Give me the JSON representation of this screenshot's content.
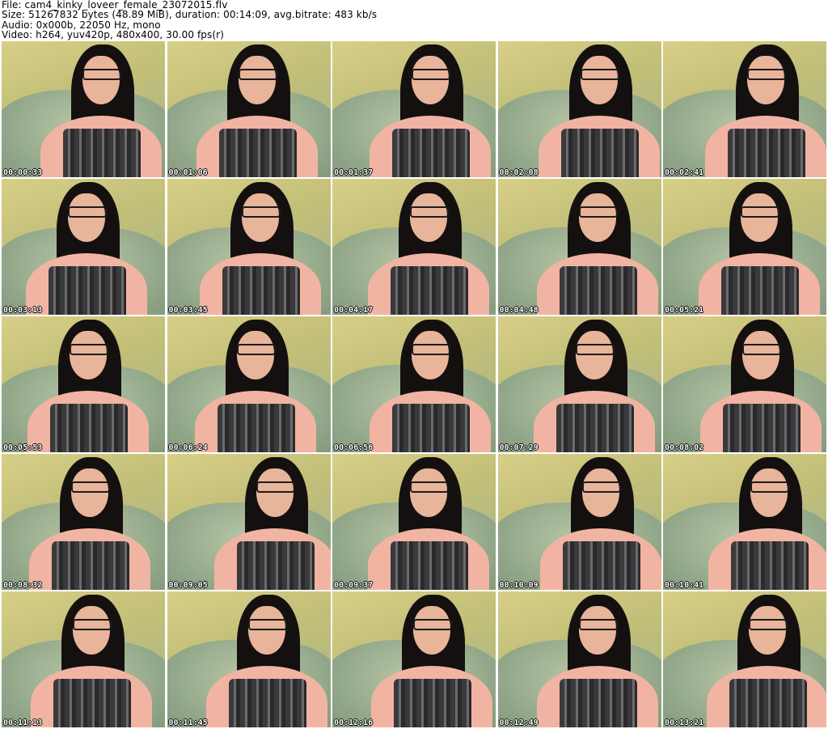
{
  "header": {
    "file_line": "File: cam4_kinky_loveer_female_23072015.flv",
    "size_line": "Size: 51267832 bytes (48.89 MiB), duration: 00:14:09, avg.bitrate: 483 kb/s",
    "audio_line": "Audio: 0x000b, 22050 Hz, mono",
    "video_line": "Video: h264, yuv420p, 480x400, 30.00 fps(r)"
  },
  "thumbnails": [
    {
      "timestamp": "00:00:33"
    },
    {
      "timestamp": "00:01:06"
    },
    {
      "timestamp": "00:01:37"
    },
    {
      "timestamp": "00:02:08"
    },
    {
      "timestamp": "00:02:41"
    },
    {
      "timestamp": "00:03:13"
    },
    {
      "timestamp": "00:03:45"
    },
    {
      "timestamp": "00:04:17"
    },
    {
      "timestamp": "00:04:48"
    },
    {
      "timestamp": "00:05:21"
    },
    {
      "timestamp": "00:05:53"
    },
    {
      "timestamp": "00:06:24"
    },
    {
      "timestamp": "00:06:56"
    },
    {
      "timestamp": "00:07:29"
    },
    {
      "timestamp": "00:08:02"
    },
    {
      "timestamp": "00:08:32"
    },
    {
      "timestamp": "00:09:05"
    },
    {
      "timestamp": "00:09:37"
    },
    {
      "timestamp": "00:10:09"
    },
    {
      "timestamp": "00:10:41"
    },
    {
      "timestamp": "00:11:13"
    },
    {
      "timestamp": "00:11:45"
    },
    {
      "timestamp": "00:12:16"
    },
    {
      "timestamp": "00:12:49"
    },
    {
      "timestamp": "00:13:21"
    }
  ]
}
